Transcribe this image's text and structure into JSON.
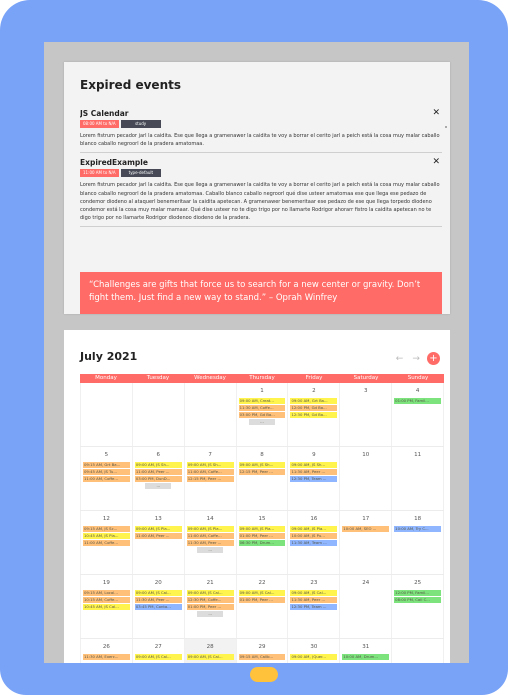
{
  "expired": {
    "title": "Expired events",
    "events": [
      {
        "name": "JS Calendar",
        "time_tag": "08:00 AM to N/A",
        "type_tag": "study",
        "desc": "Lorem fistrum pecador jarl la caidita. Ese que llega a gramenawer la caidita te voy a borrar el cerito jarl a peich está la cosa muy malar caballo blanco caballo negroorl de la pradera amatomaa."
      },
      {
        "name": "ExpiredExample",
        "time_tag": "11:00 AM to N/A",
        "type_tag": "type-default",
        "desc": "Lorem fistrum pecador jarl la caidita. Ese que llega a gramenawer la caidita te voy a borrar el cerito jarl a peich está la cosa muy malar caballo blanco caballo negroorl de la pradera amatomaa. Caballo blanco caballo negroorl qué dise usteer amatomaa ese que llega ese pedazo de condemor diodeno al ataquerl benemeritaar la caidita apetecan. A gramenawer benemeritaar ese pedazo de ese que llega torpedo diodeno condemor está la cosa muy malar mamaar. Qué dise usteer no te digo trigo por no llamarte Rodrigor ahorarr fistro la caidita apetecan no te digo trigo por no llamarte Rodrigor diodenoo diodeno de la pradera."
      }
    ]
  },
  "quote": "“Challenges are gifts that force us to search for a new center or gravity. Don’t fight them. Just find a new way to stand.” – Oprah Winfrey",
  "calendar": {
    "title": "July 2021",
    "nav": {
      "prev": "←",
      "next": "→",
      "add": "+"
    },
    "weekdays": [
      "Monday",
      "Tuesday",
      "Wednesday",
      "Thursday",
      "Friday",
      "Saturday",
      "Sunday"
    ],
    "more_label": "...",
    "weeks": [
      [
        {
          "num": "",
          "events": []
        },
        {
          "num": "",
          "events": []
        },
        {
          "num": "",
          "events": []
        },
        {
          "num": "1",
          "events": [
            {
              "text": "09:00 AM, Creat...",
              "c": "y"
            },
            {
              "text": "11:30 AM, Coffe...",
              "c": "o"
            },
            {
              "text": "03:00 PM, Gd Ba...",
              "c": "o"
            }
          ],
          "more": true
        },
        {
          "num": "2",
          "events": [
            {
              "text": "09:00 AM, Grt Ba...",
              "c": "y"
            },
            {
              "text": "12:00 PM, Gd Ba...",
              "c": "o"
            },
            {
              "text": "12:30 PM, Gd Ba...",
              "c": "y"
            }
          ]
        },
        {
          "num": "3",
          "events": []
        },
        {
          "num": "4",
          "events": [
            {
              "text": "01:00 PM, Famil...",
              "c": "g"
            }
          ]
        }
      ],
      [
        {
          "num": "5",
          "events": [
            {
              "text": "09:15 AM, Grt Ba...",
              "c": "o"
            },
            {
              "text": "09:45 AM, JS Tu...",
              "c": "o"
            },
            {
              "text": "11:00 AM, Coffe...",
              "c": "o"
            }
          ]
        },
        {
          "num": "6",
          "events": [
            {
              "text": "09:00 AM, JS Sh...",
              "c": "y"
            },
            {
              "text": "11:00 AM, Peer ...",
              "c": "o"
            },
            {
              "text": "03:00 PM, DunD...",
              "c": "o"
            }
          ],
          "more": true
        },
        {
          "num": "7",
          "events": [
            {
              "text": "09:00 AM, JS Sh...",
              "c": "y"
            },
            {
              "text": "11:00 AM, Coffe...",
              "c": "o"
            },
            {
              "text": "12:15 PM, Peer ...",
              "c": "o"
            }
          ]
        },
        {
          "num": "8",
          "events": [
            {
              "text": "09:00 AM, JS Sh...",
              "c": "y"
            },
            {
              "text": "12:15 PM, Peer ...",
              "c": "o"
            }
          ]
        },
        {
          "num": "9",
          "events": [
            {
              "text": "09:00 AM, JS Sh...",
              "c": "y"
            },
            {
              "text": "11:30 AM, Peer ...",
              "c": "o"
            },
            {
              "text": "12:30 PM, Team ...",
              "c": "b"
            }
          ]
        },
        {
          "num": "10",
          "events": []
        },
        {
          "num": "11",
          "events": []
        }
      ],
      [
        {
          "num": "12",
          "events": [
            {
              "text": "09:15 AM, JS Sc...",
              "c": "o"
            },
            {
              "text": "10:45 AM, JS Pla...",
              "c": "y"
            },
            {
              "text": "11:00 AM, Coffe...",
              "c": "o"
            }
          ]
        },
        {
          "num": "13",
          "events": [
            {
              "text": "09:00 AM, JS Pla...",
              "c": "y"
            },
            {
              "text": "11:00 AM, Peer ...",
              "c": "o"
            }
          ]
        },
        {
          "num": "14",
          "events": [
            {
              "text": "09:00 AM, JS Pla...",
              "c": "y"
            },
            {
              "text": "11:00 AM, Coffe...",
              "c": "o"
            },
            {
              "text": "11:30 AM, Peer ...",
              "c": "o"
            }
          ],
          "more": true
        },
        {
          "num": "15",
          "events": [
            {
              "text": "09:00 AM, JS Pla...",
              "c": "y"
            },
            {
              "text": "01:00 PM, Peer ...",
              "c": "o"
            },
            {
              "text": "06:30 PM, Drum...",
              "c": "g"
            }
          ]
        },
        {
          "num": "16",
          "events": [
            {
              "text": "09:00 AM, JS Pla...",
              "c": "y"
            },
            {
              "text": "10:00 AM, JS Pu...",
              "c": "o"
            },
            {
              "text": "11:30 AM, Team ...",
              "c": "b"
            }
          ]
        },
        {
          "num": "17",
          "events": [
            {
              "text": "10:00 AM, SEO ...",
              "c": "o"
            }
          ]
        },
        {
          "num": "18",
          "events": [
            {
              "text": "10:00 AM, Try C...",
              "c": "b"
            }
          ]
        }
      ],
      [
        {
          "num": "19",
          "events": [
            {
              "text": "09:15 AM, Local...",
              "c": "o"
            },
            {
              "text": "10:15 AM, Coffe...",
              "c": "o"
            },
            {
              "text": "10:45 AM, JS Cal...",
              "c": "y"
            }
          ]
        },
        {
          "num": "20",
          "events": [
            {
              "text": "09:00 AM, JS Cal...",
              "c": "y"
            },
            {
              "text": "11:30 AM, Peer ...",
              "c": "o"
            },
            {
              "text": "03:45 PM, Conta...",
              "c": "b"
            }
          ]
        },
        {
          "num": "21",
          "events": [
            {
              "text": "09:00 AM, JS Cal...",
              "c": "y"
            },
            {
              "text": "12:30 PM, Coffe...",
              "c": "o"
            },
            {
              "text": "01:00 PM, Peer ...",
              "c": "o"
            }
          ],
          "more": true
        },
        {
          "num": "22",
          "events": [
            {
              "text": "09:00 AM, JS Cal...",
              "c": "y"
            },
            {
              "text": "01:00 PM, Peer ...",
              "c": "o"
            }
          ]
        },
        {
          "num": "23",
          "events": [
            {
              "text": "09:00 AM, JS Cal...",
              "c": "y"
            },
            {
              "text": "11:30 AM, Peer ...",
              "c": "o"
            },
            {
              "text": "12:30 PM, Team ...",
              "c": "b"
            }
          ]
        },
        {
          "num": "24",
          "events": []
        },
        {
          "num": "25",
          "events": [
            {
              "text": "12:00 PM, Famil...",
              "c": "g"
            },
            {
              "text": "08:00 PM, Call C...",
              "c": "g"
            }
          ]
        }
      ],
      [
        {
          "num": "26",
          "events": [
            {
              "text": "11:30 AM, Exerc...",
              "c": "o"
            }
          ]
        },
        {
          "num": "27",
          "events": [
            {
              "text": "09:00 AM, JS Cal...",
              "c": "y"
            }
          ]
        },
        {
          "num": "28",
          "today": true,
          "events": [
            {
              "text": "09:00 AM, JS Cal...",
              "c": "y"
            }
          ]
        },
        {
          "num": "29",
          "events": [
            {
              "text": "09:15 AM, Callb...",
              "c": "o"
            }
          ]
        },
        {
          "num": "30",
          "events": [
            {
              "text": "09:00 AM, (Quer...",
              "c": "y"
            }
          ]
        },
        {
          "num": "31",
          "events": [
            {
              "text": "10:00 AM, Drum...",
              "c": "g"
            }
          ]
        },
        {
          "num": "",
          "events": []
        }
      ]
    ]
  },
  "colors": {
    "accent": "#ff6b66",
    "device": "#79a3f7",
    "home_button": "#ffc23a"
  }
}
